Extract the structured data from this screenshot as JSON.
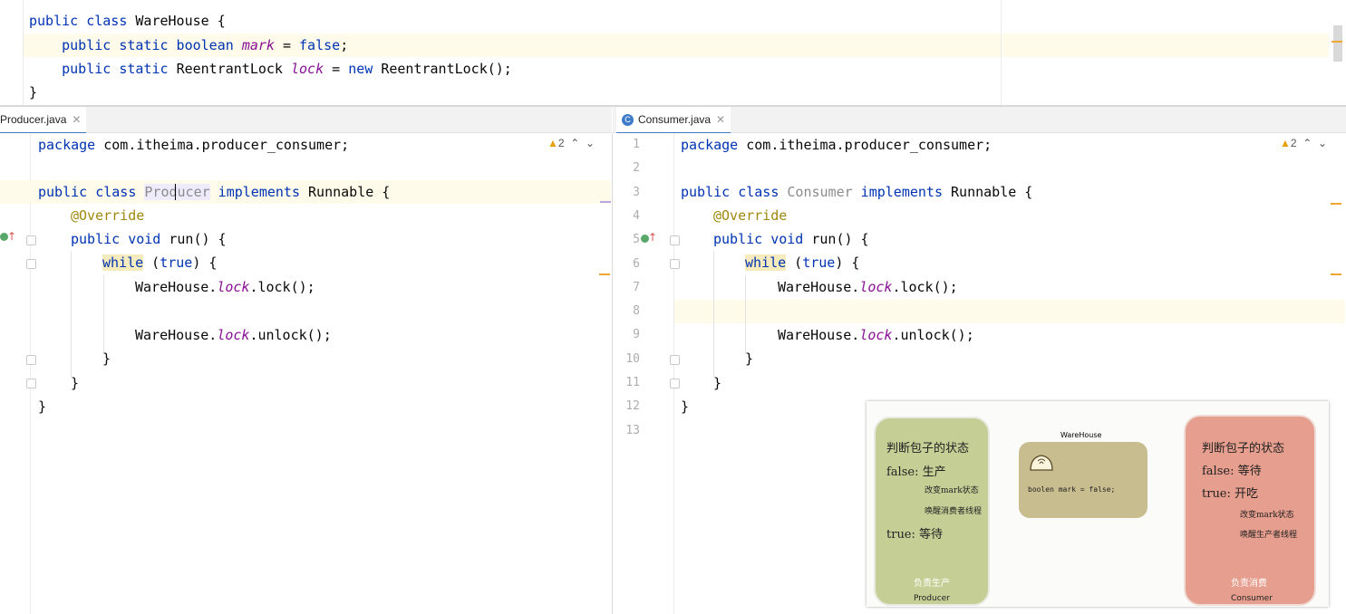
{
  "top_editor": {
    "lines": [
      {
        "p1": "public class ",
        "p2": "WareHouse {"
      },
      {
        "p1": "    public static boolean ",
        "fld": "mark",
        "p2": " = ",
        "kw2": "false",
        "p3": ";"
      },
      {
        "p1": "    public static ",
        "p2": "ReentrantLock ",
        "fld": "lock",
        "p3": " = ",
        "kw2": "new",
        "p4": " ReentrantLock();"
      },
      {
        "p1": "}"
      }
    ]
  },
  "left_pane": {
    "tab_label": "Producer.java",
    "warning_count": "2",
    "code": {
      "pkg_kw": "package",
      "pkg_name": " com.itheima.producer_consumer;",
      "class_kw": "public class ",
      "class_name": "Producer",
      "impl_kw": " implements ",
      "iface": "Runnable {",
      "override": "@Override",
      "run_kw": "public void ",
      "run": "run() {",
      "while_kw": "while",
      "while_rest": " (",
      "true_kw": "true",
      "while_end": ") {",
      "lock_a": "WareHouse.",
      "lock_f": "lock",
      "lock_b": ".lock();",
      "unlock_a": "WareHouse.",
      "unlock_f": "lock",
      "unlock_b": ".unlock();",
      "brace": "}"
    }
  },
  "right_pane": {
    "tab_label": "Consumer.java",
    "tab_icon": "C",
    "warning_count": "2",
    "line_numbers": [
      "1",
      "2",
      "3",
      "4",
      "5",
      "6",
      "7",
      "8",
      "9",
      "10",
      "11",
      "12",
      "13"
    ],
    "code": {
      "pkg_kw": "package",
      "pkg_name": " com.itheima.producer_consumer;",
      "class_kw": "public class ",
      "class_name": "Consumer",
      "impl_kw": " implements ",
      "iface": "Runnable {",
      "override": "@Override",
      "run_kw": "public void ",
      "run": "run() {",
      "while_kw": "while",
      "while_rest": " (",
      "true_kw": "true",
      "while_end": ") {",
      "lock_a": "WareHouse.",
      "lock_f": "lock",
      "lock_b": ".lock();",
      "unlock_a": "WareHouse.",
      "unlock_f": "lock",
      "unlock_b": ".unlock();",
      "brace": "}"
    }
  },
  "diagram": {
    "producer": {
      "l1": "判断包子的状态",
      "l2": "false: 生产",
      "l3": "改变mark状态",
      "l4": "唤醒消费者线程",
      "l5": "true: 等待",
      "role": "负责生产",
      "name": "Producer",
      "color": "#c5cf95"
    },
    "warehouse": {
      "title": "WareHouse",
      "code": "boolen mark = false;",
      "color": "#c8bd8f"
    },
    "consumer": {
      "l1": "判断包子的状态",
      "l2": "false: 等待",
      "l3": "true: 开吃",
      "l4": "改变mark状态",
      "l5": "唤醒生产者线程",
      "role": "负责消费",
      "name": "Consumer",
      "color": "#e69e8e"
    }
  },
  "colors": {
    "keyword": "#0033b3",
    "field": "#871094",
    "annotation": "#9e880d",
    "accent": "#3d7cc9",
    "warning": "#e6a100"
  }
}
